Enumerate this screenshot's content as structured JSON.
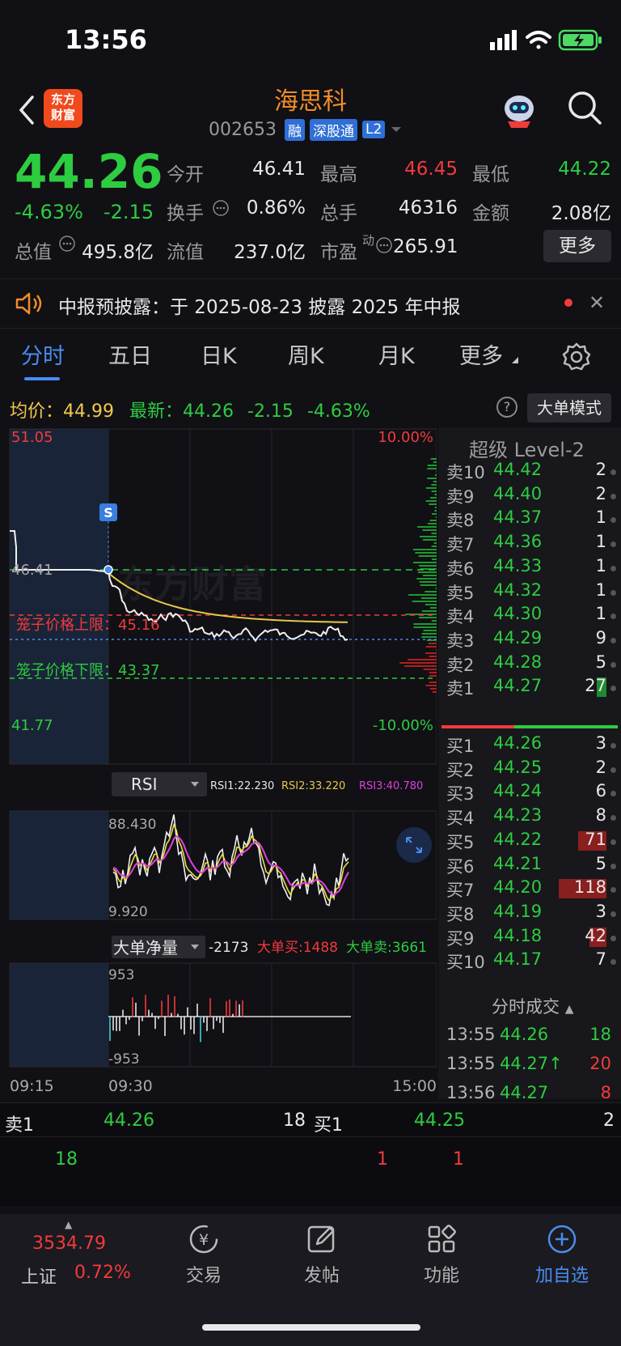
{
  "status": {
    "time": "13:56"
  },
  "header": {
    "logo_line1": "东方",
    "logo_line2": "财富",
    "stock_name": "海思科",
    "stock_code": "002653",
    "tags": [
      "融",
      "深股通",
      "L2"
    ]
  },
  "quote": {
    "price": "44.26",
    "pct": "-4.63%",
    "chg": "-2.15",
    "fields": [
      {
        "label": "今开",
        "value": "46.41",
        "color": "white"
      },
      {
        "label": "最高",
        "value": "46.45",
        "color": "red"
      },
      {
        "label": "最低",
        "value": "44.22",
        "color": "green"
      },
      {
        "label": "换手",
        "value": "0.86%",
        "color": "white"
      },
      {
        "label": "总手",
        "value": "46316",
        "color": "white"
      },
      {
        "label": "金额",
        "value": "2.08亿",
        "color": "white"
      },
      {
        "label": "总值",
        "value": "495.8亿",
        "color": "white"
      },
      {
        "label": "流值",
        "value": "237.0亿",
        "color": "white"
      },
      {
        "label": "市盈",
        "value": "265.91",
        "color": "white"
      }
    ],
    "pe_superscript": "动",
    "more_label": "更多"
  },
  "notice": {
    "text": "中报预披露：于 2025-08-23 披露 2025 年中报"
  },
  "tabs": [
    "分时",
    "五日",
    "日K",
    "周K",
    "月K",
    "更多"
  ],
  "info_line": {
    "avg_label": "均价：",
    "avg_value": "44.99",
    "last_label": "最新：",
    "last_value": "44.26",
    "last_chg": "-2.15",
    "last_pct": "-4.63%",
    "mode_button": "大单模式"
  },
  "price_chart": {
    "y_top": "51.05",
    "y_bottom": "41.77",
    "y_ref": "46.41",
    "pct_top": "10.00%",
    "pct_bottom": "-10.00%",
    "cage_upper": "笼子价格上限：45.16",
    "cage_lower": "笼子价格下限：43.37",
    "s_marker": "S",
    "watermark": "东方财富"
  },
  "rsi": {
    "label": "RSI",
    "rsi1": "RSI1:22.230",
    "rsi2": "RSI2:33.220",
    "rsi3": "RSI3:40.780",
    "top": "88.430",
    "bottom": "9.920"
  },
  "big_order": {
    "label": "大单净量",
    "net": "-2173",
    "buy": "大单买:1488",
    "sell": "大单卖:3661",
    "top": "953",
    "bottom": "-953"
  },
  "time_axis": [
    "09:15",
    "09:30",
    "15:00"
  ],
  "level2": {
    "title": "超级 Level-2",
    "asks": [
      {
        "k": "卖10",
        "p": "44.42",
        "v": "2"
      },
      {
        "k": "卖9",
        "p": "44.40",
        "v": "2"
      },
      {
        "k": "卖8",
        "p": "44.37",
        "v": "1"
      },
      {
        "k": "卖7",
        "p": "44.36",
        "v": "1"
      },
      {
        "k": "卖6",
        "p": "44.33",
        "v": "1"
      },
      {
        "k": "卖5",
        "p": "44.32",
        "v": "1"
      },
      {
        "k": "卖4",
        "p": "44.30",
        "v": "1"
      },
      {
        "k": "卖3",
        "p": "44.29",
        "v": "9"
      },
      {
        "k": "卖2",
        "p": "44.28",
        "v": "5"
      },
      {
        "k": "卖1",
        "p": "44.27",
        "v": "27"
      }
    ],
    "bids": [
      {
        "k": "买1",
        "p": "44.26",
        "v": "3"
      },
      {
        "k": "买2",
        "p": "44.25",
        "v": "2"
      },
      {
        "k": "买3",
        "p": "44.24",
        "v": "6"
      },
      {
        "k": "买4",
        "p": "44.23",
        "v": "8"
      },
      {
        "k": "买5",
        "p": "44.22",
        "v": "71"
      },
      {
        "k": "买6",
        "p": "44.21",
        "v": "5"
      },
      {
        "k": "买7",
        "p": "44.20",
        "v": "118"
      },
      {
        "k": "买8",
        "p": "44.19",
        "v": "3"
      },
      {
        "k": "买9",
        "p": "44.18",
        "v": "42"
      },
      {
        "k": "买10",
        "p": "44.17",
        "v": "7"
      }
    ],
    "trades_title": "分时成交",
    "trades": [
      {
        "t": "13:55",
        "p": "44.26",
        "v": "18",
        "color": "green"
      },
      {
        "t": "13:55",
        "p": "44.27↑",
        "v": "20",
        "color": "red"
      },
      {
        "t": "13:56",
        "p": "44.27",
        "v": "8",
        "color": "red"
      }
    ]
  },
  "strip": {
    "ask_label": "卖1",
    "ask_price": "44.26",
    "ask_vol": "18",
    "bid_label": "买1",
    "bid_price": "44.25",
    "bid_vol": "2",
    "queue_ask": "18",
    "queue_bid_a": "1",
    "queue_bid_b": "1"
  },
  "bottom_nav": {
    "index_value": "3534.79",
    "index_name": "上证",
    "index_pct": "0.72%",
    "items": [
      "交易",
      "发帖",
      "功能",
      "加自选"
    ]
  },
  "colors": {
    "up": "#f23b3b",
    "down": "#2ecc40",
    "accent": "#4a8cf0",
    "brand": "#f28c28"
  }
}
